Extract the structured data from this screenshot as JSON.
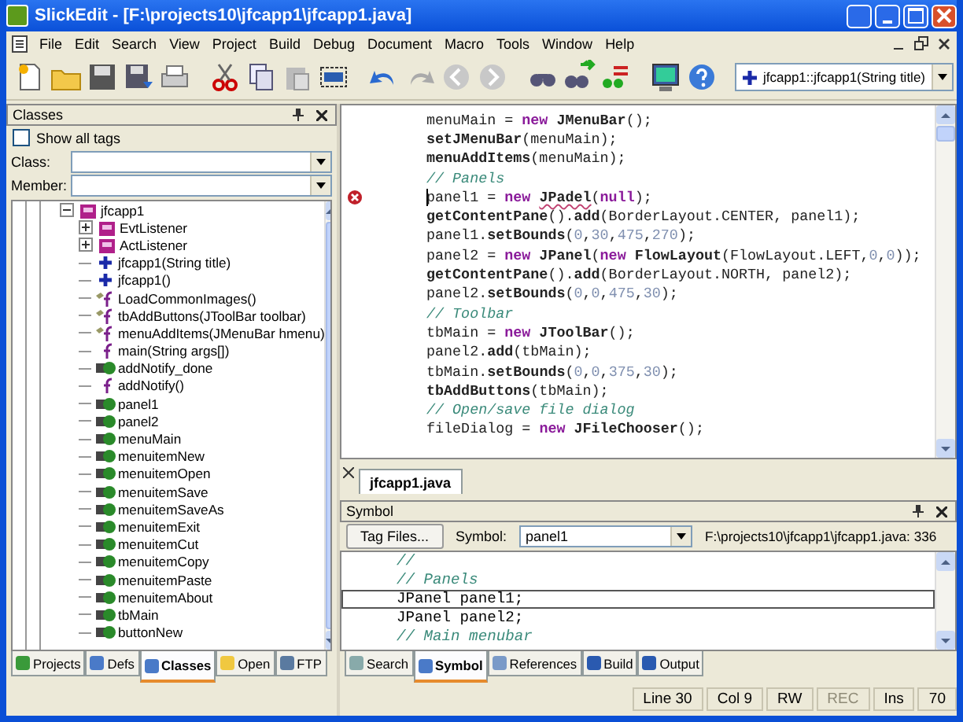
{
  "window": {
    "title": "SlickEdit - [F:\\projects10\\jfcapp1\\jfcapp1.java]"
  },
  "menu": [
    "File",
    "Edit",
    "Search",
    "View",
    "Project",
    "Build",
    "Debug",
    "Document",
    "Macro",
    "Tools",
    "Window",
    "Help"
  ],
  "context_combo": {
    "value": "jfcapp1::jfcapp1(String title)"
  },
  "classes_panel": {
    "title": "Classes",
    "show_all_tags": {
      "label": "Show all tags",
      "checked": false
    },
    "class_label": "Class:",
    "member_label": "Member:",
    "tree": [
      {
        "label": "jfcapp1",
        "kind": "class",
        "expanded": true,
        "children": [
          {
            "label": "EvtListener",
            "kind": "class",
            "expanded": false
          },
          {
            "label": "ActListener",
            "kind": "class",
            "expanded": false
          },
          {
            "label": "jfcapp1(String title)",
            "kind": "constructor"
          },
          {
            "label": "jfcapp1()",
            "kind": "constructor"
          },
          {
            "label": "LoadCommonImages()",
            "kind": "protected"
          },
          {
            "label": "tbAddButtons(JToolBar toolbar)",
            "kind": "protected"
          },
          {
            "label": "menuAddItems(JMenuBar hmenu)",
            "kind": "protected"
          },
          {
            "label": "main(String args[])",
            "kind": "method"
          },
          {
            "label": "addNotify_done",
            "kind": "field"
          },
          {
            "label": "addNotify()",
            "kind": "method"
          },
          {
            "label": "panel1",
            "kind": "field"
          },
          {
            "label": "panel2",
            "kind": "field"
          },
          {
            "label": "menuMain",
            "kind": "field"
          },
          {
            "label": "menuitemNew",
            "kind": "field"
          },
          {
            "label": "menuitemOpen",
            "kind": "field"
          },
          {
            "label": "menuitemSave",
            "kind": "field"
          },
          {
            "label": "menuitemSaveAs",
            "kind": "field"
          },
          {
            "label": "menuitemExit",
            "kind": "field"
          },
          {
            "label": "menuitemCut",
            "kind": "field"
          },
          {
            "label": "menuitemCopy",
            "kind": "field"
          },
          {
            "label": "menuitemPaste",
            "kind": "field"
          },
          {
            "label": "menuitemAbout",
            "kind": "field"
          },
          {
            "label": "tbMain",
            "kind": "field"
          },
          {
            "label": "buttonNew",
            "kind": "field"
          }
        ]
      }
    ],
    "tabs": [
      {
        "label": "Projects",
        "selected": false
      },
      {
        "label": "Defs",
        "selected": false
      },
      {
        "label": "Classes",
        "selected": true
      },
      {
        "label": "Open",
        "selected": false
      },
      {
        "label": "FTP",
        "selected": false
      }
    ]
  },
  "editor": {
    "lines": [
      {
        "tokens": [
          {
            "kind": "plain",
            "text": "menuMain = "
          },
          {
            "kind": "keyword",
            "text": "new"
          },
          {
            "kind": "call",
            "text": " JMenuBar"
          },
          {
            "kind": "plain",
            "text": "();"
          }
        ]
      },
      {
        "tokens": [
          {
            "kind": "call",
            "text": "setJMenuBar"
          },
          {
            "kind": "plain",
            "text": "(menuMain);"
          }
        ]
      },
      {
        "tokens": [
          {
            "kind": "call",
            "text": "menuAddItems"
          },
          {
            "kind": "plain",
            "text": "(menuMain);"
          }
        ]
      },
      {
        "tokens": [
          {
            "kind": "comment",
            "text": "// Panels"
          }
        ]
      },
      {
        "error": true,
        "cursor": true,
        "tokens": [
          {
            "kind": "plain",
            "text": "panel1 = "
          },
          {
            "kind": "keyword",
            "text": "new "
          },
          {
            "kind": "call",
            "text": "JPadel",
            "squiggle": true
          },
          {
            "kind": "plain",
            "text": "("
          },
          {
            "kind": "keyword",
            "text": "null"
          },
          {
            "kind": "plain",
            "text": ");"
          }
        ]
      },
      {
        "tokens": [
          {
            "kind": "call",
            "text": "getContentPane"
          },
          {
            "kind": "plain",
            "text": "()."
          },
          {
            "kind": "call",
            "text": "add"
          },
          {
            "kind": "plain",
            "text": "(BorderLayout.CENTER, panel1);"
          }
        ]
      },
      {
        "tokens": [
          {
            "kind": "plain",
            "text": "panel1."
          },
          {
            "kind": "call",
            "text": "setBounds"
          },
          {
            "kind": "plain",
            "text": "("
          },
          {
            "kind": "number",
            "text": "0"
          },
          {
            "kind": "plain",
            "text": ","
          },
          {
            "kind": "number",
            "text": "30"
          },
          {
            "kind": "plain",
            "text": ","
          },
          {
            "kind": "number",
            "text": "475"
          },
          {
            "kind": "plain",
            "text": ","
          },
          {
            "kind": "number",
            "text": "270"
          },
          {
            "kind": "plain",
            "text": ");"
          }
        ]
      },
      {
        "tokens": [
          {
            "kind": "plain",
            "text": "panel2 = "
          },
          {
            "kind": "keyword",
            "text": "new"
          },
          {
            "kind": "call",
            "text": " JPanel"
          },
          {
            "kind": "plain",
            "text": "("
          },
          {
            "kind": "keyword",
            "text": "new"
          },
          {
            "kind": "call",
            "text": " FlowLayout"
          },
          {
            "kind": "plain",
            "text": "(FlowLayout.LEFT,"
          },
          {
            "kind": "number",
            "text": "0"
          },
          {
            "kind": "plain",
            "text": ","
          },
          {
            "kind": "number",
            "text": "0"
          },
          {
            "kind": "plain",
            "text": "));"
          }
        ]
      },
      {
        "tokens": [
          {
            "kind": "call",
            "text": "getContentPane"
          },
          {
            "kind": "plain",
            "text": "()."
          },
          {
            "kind": "call",
            "text": "add"
          },
          {
            "kind": "plain",
            "text": "(BorderLayout.NORTH, panel2);"
          }
        ]
      },
      {
        "tokens": [
          {
            "kind": "plain",
            "text": "panel2."
          },
          {
            "kind": "call",
            "text": "setBounds"
          },
          {
            "kind": "plain",
            "text": "("
          },
          {
            "kind": "number",
            "text": "0"
          },
          {
            "kind": "plain",
            "text": ","
          },
          {
            "kind": "number",
            "text": "0"
          },
          {
            "kind": "plain",
            "text": ","
          },
          {
            "kind": "number",
            "text": "475"
          },
          {
            "kind": "plain",
            "text": ","
          },
          {
            "kind": "number",
            "text": "30"
          },
          {
            "kind": "plain",
            "text": ");"
          }
        ]
      },
      {
        "tokens": [
          {
            "kind": "comment",
            "text": "// Toolbar"
          }
        ]
      },
      {
        "tokens": [
          {
            "kind": "plain",
            "text": "tbMain = "
          },
          {
            "kind": "keyword",
            "text": "new"
          },
          {
            "kind": "call",
            "text": " JToolBar"
          },
          {
            "kind": "plain",
            "text": "();"
          }
        ]
      },
      {
        "tokens": [
          {
            "kind": "plain",
            "text": "panel2."
          },
          {
            "kind": "call",
            "text": "add"
          },
          {
            "kind": "plain",
            "text": "(tbMain);"
          }
        ]
      },
      {
        "tokens": [
          {
            "kind": "plain",
            "text": "tbMain."
          },
          {
            "kind": "call",
            "text": "setBounds"
          },
          {
            "kind": "plain",
            "text": "("
          },
          {
            "kind": "number",
            "text": "0"
          },
          {
            "kind": "plain",
            "text": ","
          },
          {
            "kind": "number",
            "text": "0"
          },
          {
            "kind": "plain",
            "text": ","
          },
          {
            "kind": "number",
            "text": "375"
          },
          {
            "kind": "plain",
            "text": ","
          },
          {
            "kind": "number",
            "text": "30"
          },
          {
            "kind": "plain",
            "text": ");"
          }
        ]
      },
      {
        "tokens": [
          {
            "kind": "call",
            "text": "tbAddButtons"
          },
          {
            "kind": "plain",
            "text": "(tbMain);"
          }
        ]
      },
      {
        "tokens": [
          {
            "kind": "comment",
            "text": "// Open/save file dialog"
          }
        ]
      },
      {
        "tokens": [
          {
            "kind": "plain",
            "text": "fileDialog = "
          },
          {
            "kind": "keyword",
            "text": "new"
          },
          {
            "kind": "call",
            "text": " JFileChooser"
          },
          {
            "kind": "plain",
            "text": "();"
          }
        ]
      }
    ]
  },
  "file_tabs": [
    {
      "label": "jfcapp1.java",
      "selected": true
    }
  ],
  "symbol_panel": {
    "title": "Symbol",
    "tag_files_button": "Tag Files...",
    "symbol_label": "Symbol:",
    "symbol_value": "panel1",
    "location": "F:\\projects10\\jfcapp1\\jfcapp1.java: 336",
    "lines": [
      {
        "kind": "comment",
        "text": "//",
        "selected": false
      },
      {
        "kind": "comment",
        "text": "// Panels",
        "selected": false
      },
      {
        "kind": "plain",
        "text": "JPanel panel1;",
        "selected": true
      },
      {
        "kind": "plain",
        "text": "JPanel panel2;",
        "selected": false
      },
      {
        "kind": "comment",
        "text": "// Main menubar",
        "selected": false
      }
    ],
    "tabs": [
      {
        "label": "Search",
        "selected": false
      },
      {
        "label": "Symbol",
        "selected": true
      },
      {
        "label": "References",
        "selected": false
      },
      {
        "label": "Build",
        "selected": false
      },
      {
        "label": "Output",
        "selected": false
      }
    ]
  },
  "status_bar": [
    {
      "text": "Line 30",
      "disabled": false
    },
    {
      "text": "Col 9",
      "disabled": false
    },
    {
      "text": "RW",
      "disabled": false
    },
    {
      "text": "REC",
      "disabled": true
    },
    {
      "text": "Ins",
      "disabled": false
    },
    {
      "text": "70",
      "disabled": false
    }
  ]
}
